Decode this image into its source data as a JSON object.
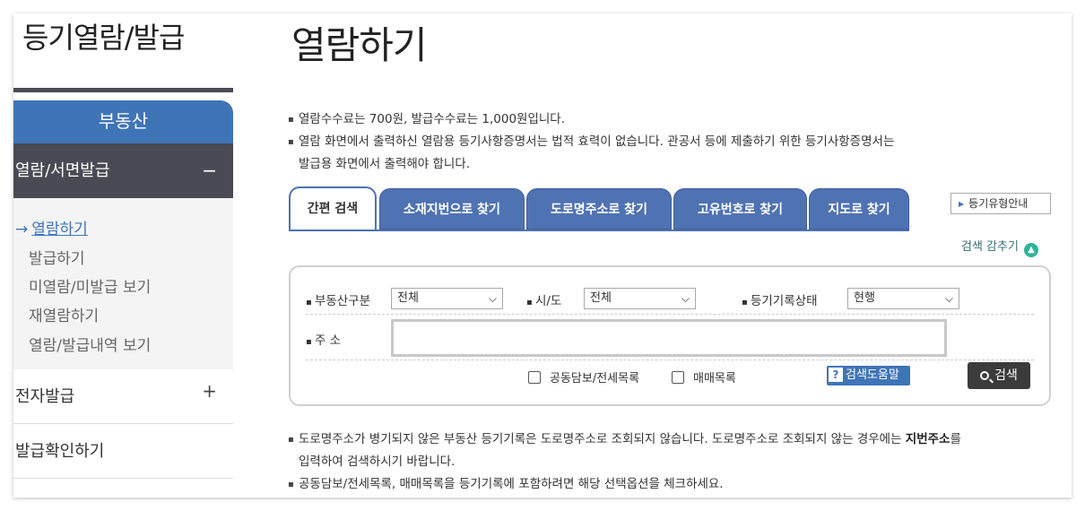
{
  "sidebar": {
    "title": "등기열람/발급",
    "category": "부동산",
    "section": {
      "label": "열람/서면발급",
      "toggle": "−"
    },
    "sub_items": [
      {
        "label": "열람하기",
        "active": true,
        "arrow": "→"
      },
      {
        "label": "발급하기"
      },
      {
        "label": "미열람/미발급 보기"
      },
      {
        "label": "재열람하기"
      },
      {
        "label": "열람/발급내역 보기"
      }
    ],
    "rows": [
      {
        "label": "전자발급",
        "toggle": "+"
      },
      {
        "label": "발급확인하기"
      }
    ]
  },
  "main": {
    "title": "열람하기",
    "notes_top": [
      "열람수수료는 700원, 발급수수료는 1,000원입니다.",
      "열람 화면에서 출력하신 열람용 등기사항증명서는 법적 효력이 없습니다. 관공서 등에 제출하기 위한 등기사항증명서는",
      "발급용 화면에서 출력해야 합니다."
    ],
    "tabs": [
      "간편 검색",
      "소재지번으로 찾기",
      "도로명주소로 찾기",
      "고유번호로 찾기",
      "지도로 찾기"
    ],
    "active_tab": 0,
    "guide_button": "등기유형안내",
    "hide_search": "검색 감추기",
    "search": {
      "property_type_label": "부동산구분",
      "property_type_value": "전체",
      "region_label": "시/도",
      "region_value": "전체",
      "status_label": "등기기록상태",
      "status_value": "현행",
      "address_label": "주 소",
      "address_value": "",
      "check_joint": "공동담보/전세목록",
      "check_sale": "매매목록",
      "help_label": "검색도움말",
      "search_label": "검색"
    },
    "notes_bottom": {
      "line1_a": "도로명주소가 병기되지 않은 부동산 등기기록은 도로명주소로 조회되지 않습니다. 도로명주소로 조회되지 않는 경우에는 ",
      "line1_bold": "지번주소",
      "line1_b": "를",
      "line2": "입력하여 검색하시기 바랍니다.",
      "line3": "공동담보/전세목록, 매매목록을 등기기록에 포함하려면 해당 선택옵션을 체크하세요."
    }
  }
}
